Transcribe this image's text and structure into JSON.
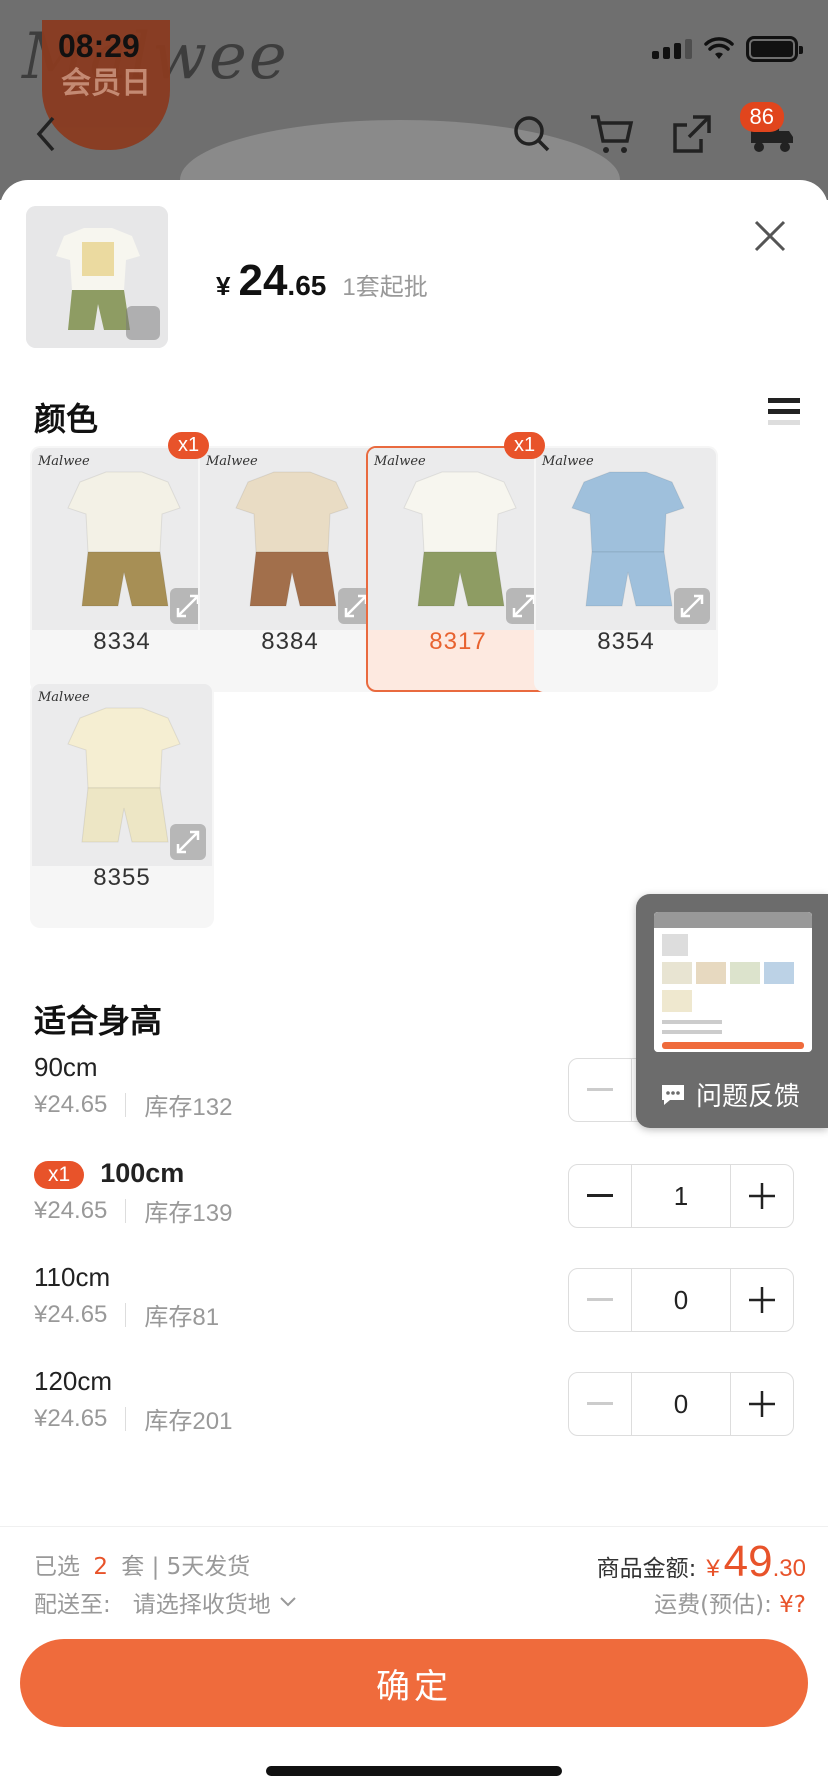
{
  "status_bar": {
    "time": "08:29"
  },
  "header": {
    "brand_text": "Malwee",
    "promo_badge": "会员日",
    "cart_count": "86"
  },
  "sheet": {
    "price_currency": "¥",
    "price_int": "24",
    "price_dec": ".65",
    "min_order": "1套起批"
  },
  "color_section": {
    "title": "颜色",
    "options": [
      {
        "code": "8334",
        "qty_badge": "x1",
        "selected": false,
        "shirt": "#f3f1e6",
        "pants": "#a78f55"
      },
      {
        "code": "8384",
        "qty_badge": "",
        "selected": false,
        "shirt": "#e9dcc4",
        "pants": "#a26f4b"
      },
      {
        "code": "8317",
        "qty_badge": "x1",
        "selected": true,
        "shirt": "#f7f6ef",
        "pants": "#8e9c63"
      },
      {
        "code": "8354",
        "qty_badge": "",
        "selected": false,
        "shirt": "#9fc0dc",
        "pants": "#9fc0dc"
      },
      {
        "code": "8355",
        "qty_badge": "",
        "selected": false,
        "shirt": "#f5eed2",
        "pants": "#ede6c5"
      }
    ]
  },
  "size_section": {
    "title": "适合身高",
    "rows": [
      {
        "name": "90cm",
        "price": "¥24.65",
        "stock": "库存132",
        "qty": "0",
        "badge": ""
      },
      {
        "name": "100cm",
        "price": "¥24.65",
        "stock": "库存139",
        "qty": "1",
        "badge": "x1"
      },
      {
        "name": "110cm",
        "price": "¥24.65",
        "stock": "库存81",
        "qty": "0",
        "badge": ""
      },
      {
        "name": "120cm",
        "price": "¥24.65",
        "stock": "库存201",
        "qty": "0",
        "badge": ""
      }
    ]
  },
  "feedback": {
    "label": "问题反馈"
  },
  "footer": {
    "selected_prefix": "已选",
    "selected_count": "2",
    "selected_suffix": "套 | 5天发货",
    "ship_to_label": "配送至:",
    "ship_to_value": "请选择收货地",
    "amount_label": "商品金额:",
    "amount_currency": "¥",
    "amount_int": "49",
    "amount_dec": ".30",
    "freight_label": "运费(预估):",
    "freight_value": "¥?",
    "confirm_label": "确定"
  },
  "colors": {
    "accent": "#ef6b3c",
    "badge": "#e8532a"
  }
}
